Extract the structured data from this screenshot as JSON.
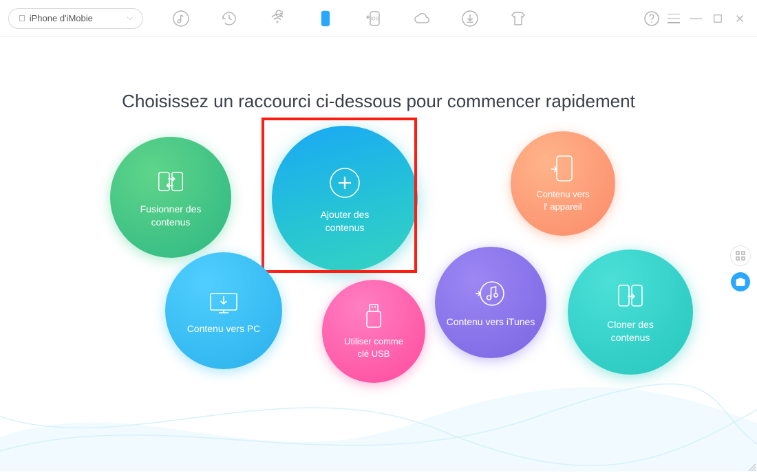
{
  "device": {
    "name": "iPhone d'iMobie"
  },
  "toolbarIcons": {
    "music": "music-icon",
    "history": "history-icon",
    "wifi": "wifi-refresh-icon",
    "phone": "phone-icon",
    "ios": "ios-transfer-icon",
    "cloud": "cloud-icon",
    "download": "download-icon",
    "skin": "skin-icon"
  },
  "heading": "Choisissez un raccourci ci-dessous pour commencer rapidement",
  "shortcuts": {
    "merge": {
      "label": "Fusionner des\ncontenus"
    },
    "add": {
      "label": "Ajouter des\ncontenus"
    },
    "toDevice": {
      "label": "Contenu vers\nl' appareil"
    },
    "toPC": {
      "label": "Contenu vers PC"
    },
    "usb": {
      "label": "Utiliser comme\nclé USB"
    },
    "toItunes": {
      "label": "Contenu vers iTunes"
    },
    "clone": {
      "label": "Cloner des\ncontenus"
    }
  },
  "sideButtons": {
    "grid": "grid-view",
    "briefcase": "shortcut-view"
  }
}
